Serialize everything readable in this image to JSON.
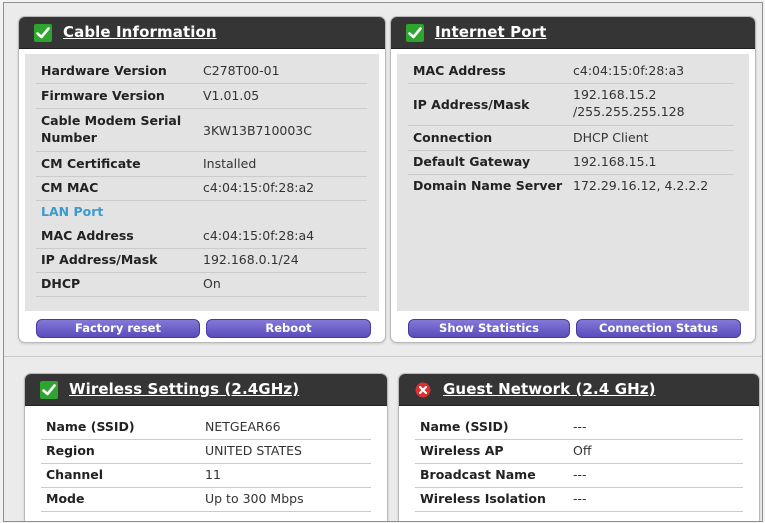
{
  "cable_info": {
    "title": "Cable Information",
    "rows": [
      {
        "label": "Hardware Version",
        "value": "C278T00-01"
      },
      {
        "label": "Firmware Version",
        "value": "V1.01.05"
      },
      {
        "label": "Cable Modem Serial Number",
        "value": "3KW13B710003C"
      },
      {
        "label": "CM Certificate",
        "value": "Installed"
      },
      {
        "label": "CM MAC",
        "value": "c4:04:15:0f:28:a2"
      },
      {
        "label": "LAN Port",
        "value": ""
      },
      {
        "label": "MAC Address",
        "value": "c4:04:15:0f:28:a4"
      },
      {
        "label": "IP Address/Mask",
        "value": "192.168.0.1/24"
      },
      {
        "label": "DHCP",
        "value": "On"
      }
    ],
    "factory_reset": "Factory reset",
    "reboot": "Reboot"
  },
  "internet_port": {
    "title": "Internet Port",
    "rows": [
      {
        "label": "MAC Address",
        "value": "c4:04:15:0f:28:a3"
      },
      {
        "label": "IP Address/Mask",
        "value": "192.168.15.2",
        "value2": "/255.255.255.128"
      },
      {
        "label": "Connection",
        "value": "DHCP Client"
      },
      {
        "label": "Default Gateway",
        "value": "192.168.15.1"
      },
      {
        "label": "Domain Name Server",
        "value": "172.29.16.12, 4.2.2.2"
      }
    ],
    "show_statistics": "Show Statistics",
    "connection_status": "Connection Status"
  },
  "wireless": {
    "title": "Wireless Settings (2.4GHz)",
    "rows": [
      {
        "label": "Name (SSID)",
        "value": "NETGEAR66"
      },
      {
        "label": "Region",
        "value": "UNITED STATES"
      },
      {
        "label": "Channel",
        "value": "11"
      },
      {
        "label": "Mode",
        "value": "Up to 300 Mbps"
      }
    ]
  },
  "guest": {
    "title": "Guest Network (2.4 GHz)",
    "rows": [
      {
        "label": "Name (SSID)",
        "value": "---"
      },
      {
        "label": "Wireless AP",
        "value": "Off"
      },
      {
        "label": "Broadcast Name",
        "value": "---"
      },
      {
        "label": "Wireless Isolation",
        "value": "---"
      }
    ]
  },
  "colors": {
    "header": "#353535",
    "check": "#2ea52e",
    "error": "#d93030",
    "button": "#6a5cc8",
    "sub_heading": "#3a9bd0"
  }
}
